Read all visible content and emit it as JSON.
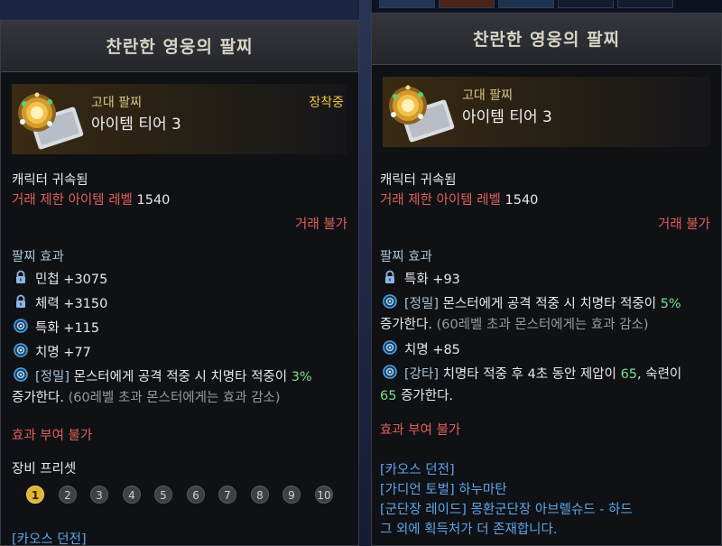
{
  "left": {
    "title": "찬란한 영웅의 팔찌",
    "category": "고대 팔찌",
    "tier": "아이템 티어 3",
    "equipped": "장착중",
    "bound": "캐릭터 귀속됨",
    "level_label": "거래 제한 아이템 레벨",
    "level_value": "1540",
    "trade": "거래 불가",
    "effects_header": "팔찌 효과",
    "effects": [
      {
        "text": "민첩 +3075"
      },
      {
        "text": "체력 +3150"
      },
      {
        "text": "특화 +115"
      },
      {
        "text": "치명 +77"
      },
      {
        "prefix": "[정밀]",
        "text": "몬스터에게 공격 적중 시 치명타 적중이",
        "value": "3%",
        "cont": "증가한다.",
        "note": "(60레벨 초과 몬스터에게는 효과 감소)"
      }
    ],
    "no_grant": "효과 부여 불가",
    "preset_label": "장비 프리셋",
    "presets": [
      "1",
      "2",
      "3",
      "4",
      "5",
      "6",
      "7",
      "8",
      "9",
      "10"
    ],
    "source": "[카오스 던전]"
  },
  "right": {
    "title": "찬란한 영웅의 팔찌",
    "category": "고대 팔찌",
    "tier": "아이템 티어 3",
    "bound": "캐릭터 귀속됨",
    "level_label": "거래 제한 아이템 레벨",
    "level_value": "1540",
    "trade": "거래 불가",
    "effects_header": "팔찌 효과",
    "effects": [
      {
        "text": "특화 +93"
      },
      {
        "prefix": "[정밀]",
        "text": "몬스터에게 공격 적중 시 치명타 적중이",
        "value": "5%",
        "cont": "증가한다.",
        "note": "(60레벨 초과 몬스터에게는 효과 감소)"
      },
      {
        "text": "치명 +85"
      },
      {
        "prefix": "[강타]",
        "text": "치명타 적중 후 4초 동안 제압이",
        "value": "65",
        "mid": ", 숙련이",
        "value2": "65",
        "cont": "증가한다."
      }
    ],
    "no_grant": "효과 부여 불가",
    "sources": [
      "[카오스 던전]",
      "[가디언 토벌] 하누마탄",
      "[군단장 레이드] 몽환군단장 아브렐슈드 - 하드",
      "그 외에 획득처가 더 존재합니다."
    ]
  },
  "colors": {
    "accent_gold": "#f2c641",
    "red": "#e0605a",
    "green": "#7ee08a",
    "blue": "#5ea6e8"
  },
  "icons": [
    "lock-icon",
    "gem-icon",
    "bracelet-icon"
  ]
}
